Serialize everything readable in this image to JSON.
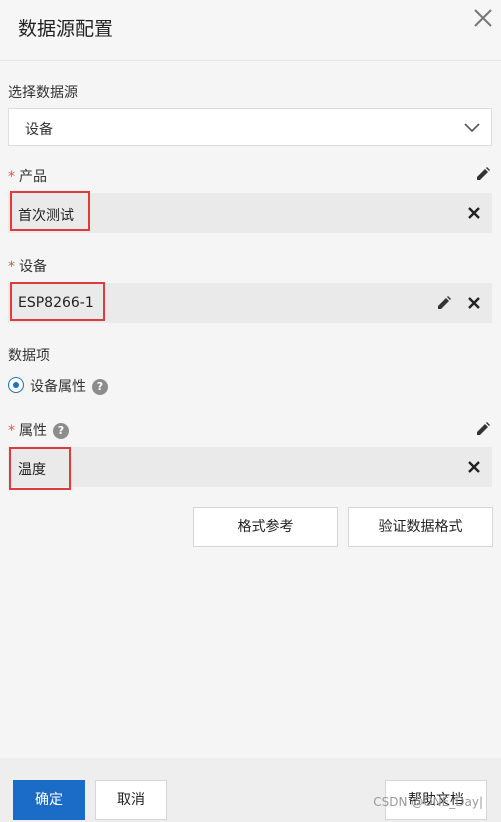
{
  "header": {
    "title": "数据源配置"
  },
  "datasource": {
    "label": "选择数据源",
    "value": "设备"
  },
  "product": {
    "required_mark": "*",
    "label": "产品",
    "value": "首次测试"
  },
  "device": {
    "required_mark": "*",
    "label": "设备",
    "value": "ESP8266-1"
  },
  "data_item": {
    "label": "数据项",
    "option_label": "设备属性",
    "help": "?"
  },
  "attribute": {
    "required_mark": "*",
    "label": "属性",
    "help": "?",
    "value": "温度"
  },
  "actions": {
    "format_ref": "格式参考",
    "verify_format": "验证数据格式"
  },
  "footer": {
    "confirm": "确定",
    "cancel": "取消",
    "help_doc": "帮助文档",
    "watermark": "CSDN @ONE_Day|"
  },
  "colors": {
    "primary": "#1b6cc6",
    "highlight_box": "#e03b3b",
    "required": "#e05252"
  }
}
